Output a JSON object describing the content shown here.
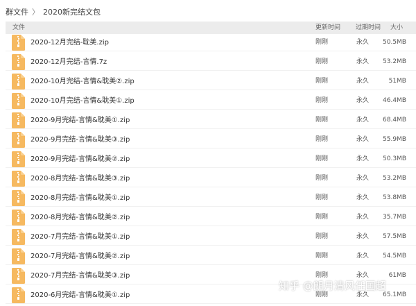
{
  "breadcrumb": {
    "root": "群文件",
    "separator": "〉",
    "current": "2020新完结文包"
  },
  "table": {
    "columns": {
      "file": "文件",
      "updated": "更新时间",
      "expires": "过期时间",
      "size": "大小"
    },
    "rows": [
      {
        "name": "2020-12月完结-耽美.zip",
        "updated": "刚刚",
        "expires": "永久",
        "size": "50.5MB"
      },
      {
        "name": "2020-12月完结-言情.7z",
        "updated": "刚刚",
        "expires": "永久",
        "size": "53.2MB"
      },
      {
        "name": "2020-10月完结-言情&耽美②.zip",
        "updated": "刚刚",
        "expires": "永久",
        "size": "51MB"
      },
      {
        "name": "2020-10月完结-言情&耽美①.zip",
        "updated": "刚刚",
        "expires": "永久",
        "size": "46.4MB"
      },
      {
        "name": "2020-9月完结-言情&耽美①.zip",
        "updated": "刚刚",
        "expires": "永久",
        "size": "68.4MB"
      },
      {
        "name": "2020-9月完结-言情&耽美③.zip",
        "updated": "刚刚",
        "expires": "永久",
        "size": "55.9MB"
      },
      {
        "name": "2020-9月完结-言情&耽美②.zip",
        "updated": "刚刚",
        "expires": "永久",
        "size": "50.3MB"
      },
      {
        "name": "2020-8月完结-言情&耽美③.zip",
        "updated": "刚刚",
        "expires": "永久",
        "size": "53.2MB"
      },
      {
        "name": "2020-8月完结-言情&耽美①.zip",
        "updated": "刚刚",
        "expires": "永久",
        "size": "53.8MB"
      },
      {
        "name": "2020-8月完结-言情&耽美②.zip",
        "updated": "刚刚",
        "expires": "永久",
        "size": "35.7MB"
      },
      {
        "name": "2020-7月完结-言情&耽美①.zip",
        "updated": "刚刚",
        "expires": "永久",
        "size": "57.5MB"
      },
      {
        "name": "2020-7月完结-言情&耽美②.zip",
        "updated": "刚刚",
        "expires": "永久",
        "size": "54.5MB"
      },
      {
        "name": "2020-7月完结-言情&耽美③.zip",
        "updated": "刚刚",
        "expires": "永久",
        "size": "61MB"
      },
      {
        "name": "2020-6月完结-言情&耽美①.zip",
        "updated": "刚刚",
        "expires": "永久",
        "size": "65.1MB"
      }
    ]
  },
  "watermark": "知乎 @朗月清风任国超",
  "icons": {
    "file_icon": "zip-archive-icon",
    "separator_icon": "chevron-right-icon"
  },
  "colors": {
    "file_icon_fill": "#f6b960",
    "file_icon_fold": "#f9d08f",
    "file_icon_zipper": "#ffffff",
    "header_bg": "#ececec"
  }
}
